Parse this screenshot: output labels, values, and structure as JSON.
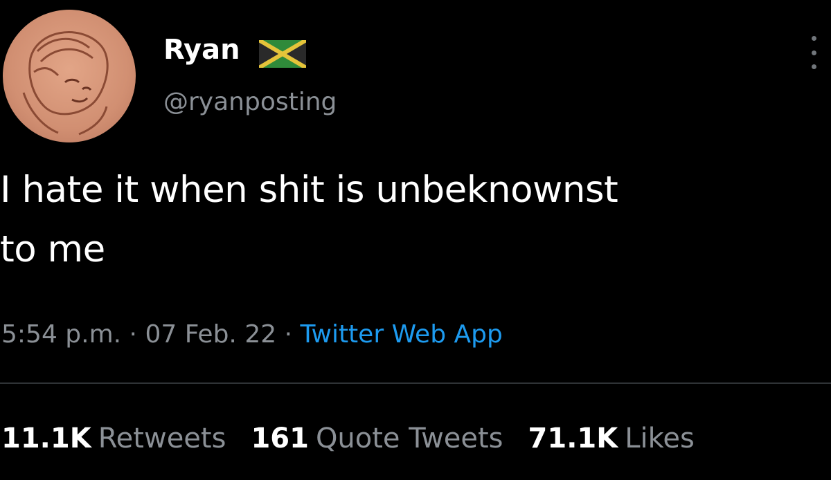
{
  "user": {
    "display_name": "Ryan",
    "handle": "@ryanposting",
    "flag_icon": "jamaica-flag-icon"
  },
  "tweet": {
    "text_lines": [
      "I hate it when shit is unbeknownst",
      "to me"
    ]
  },
  "meta": {
    "time": "5:54 p.m.",
    "separator": " · ",
    "date": "07 Feb. 22",
    "source": "Twitter Web App"
  },
  "stats": {
    "retweets_count": "11.1K",
    "retweets_label": "Retweets",
    "quote_count": "161",
    "quote_label": "Quote Tweets",
    "likes_count": "71.1K",
    "likes_label": "Likes"
  },
  "colors": {
    "background": "#000000",
    "text": "#ffffff",
    "secondary": "#8b9096",
    "link": "#1d9bf0",
    "divider": "#2f3336"
  }
}
